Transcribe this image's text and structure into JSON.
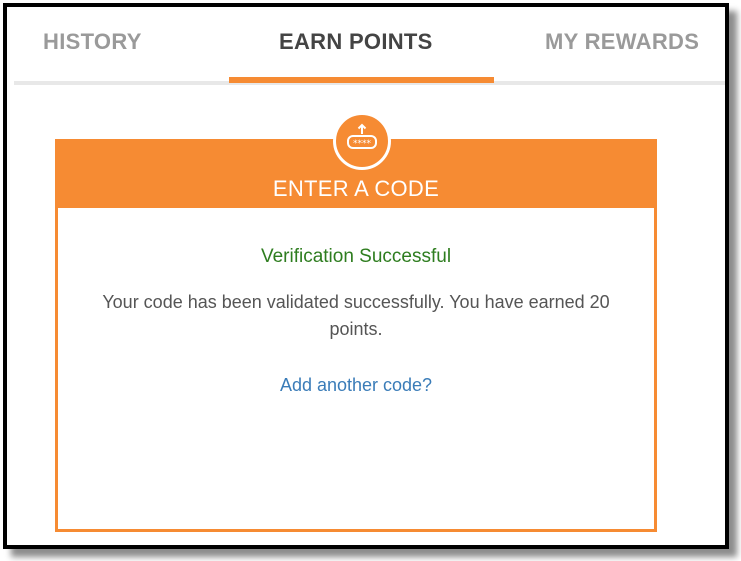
{
  "tabs": {
    "history": "HISTORY",
    "earn_points": "EARN POINTS",
    "my_rewards": "MY REWARDS",
    "active": "EARN POINTS"
  },
  "card": {
    "title": "ENTER A CODE",
    "icon": "code-entry-icon",
    "status": "Verification Successful",
    "message": "Your code has been validated successfully. You have earned 20 points.",
    "link": "Add another code?"
  },
  "colors": {
    "accent": "#f68b33",
    "success": "#2e7d1f",
    "link": "#3a7cb8",
    "inactive_tab": "#9a9a9a",
    "active_tab": "#444444"
  }
}
